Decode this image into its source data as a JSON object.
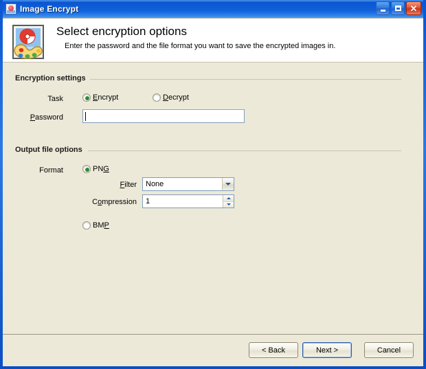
{
  "window": {
    "title": "Image Encrypt",
    "icon": "image-encrypt-icon",
    "controls": {
      "minimize": "minimize-button",
      "maximize": "maximize-button",
      "close": "close-button",
      "close_glyph": "✕"
    }
  },
  "header": {
    "title": "Select encryption options",
    "subtitle": "Enter the password and the file format you want to save the encrypted images in.",
    "icon": "picture-palette-icon"
  },
  "encryption_settings": {
    "group_label": "Encryption settings",
    "task": {
      "label": "Task",
      "options": [
        {
          "label": "Encrypt",
          "mnemonic": "E",
          "checked": true
        },
        {
          "label": "Decrypt",
          "mnemonic": "D",
          "checked": false
        }
      ]
    },
    "password": {
      "label": "Password",
      "mnemonic": "P",
      "value": "",
      "placeholder": ""
    }
  },
  "output_file_options": {
    "group_label": "Output file options",
    "format": {
      "label": "Format",
      "options": [
        {
          "label": "PNG",
          "mnemonic": "G",
          "checked": true
        },
        {
          "label": "BMP",
          "mnemonic": "P",
          "checked": false
        }
      ]
    },
    "filter": {
      "label": "Filter",
      "mnemonic": "F",
      "value": "None",
      "options": [
        "None"
      ]
    },
    "compression": {
      "label": "Compression",
      "mnemonic": "o",
      "value": "1"
    }
  },
  "footer": {
    "back": "< Back",
    "next": "Next >",
    "cancel": "Cancel"
  },
  "colors": {
    "window_frame": "#0a55d0",
    "client_background": "#ece9d8",
    "header_background": "#ffffff",
    "radio_selected": "#2e8b30",
    "default_button_border": "#2c5fa8",
    "close_button": "#c8331a"
  }
}
